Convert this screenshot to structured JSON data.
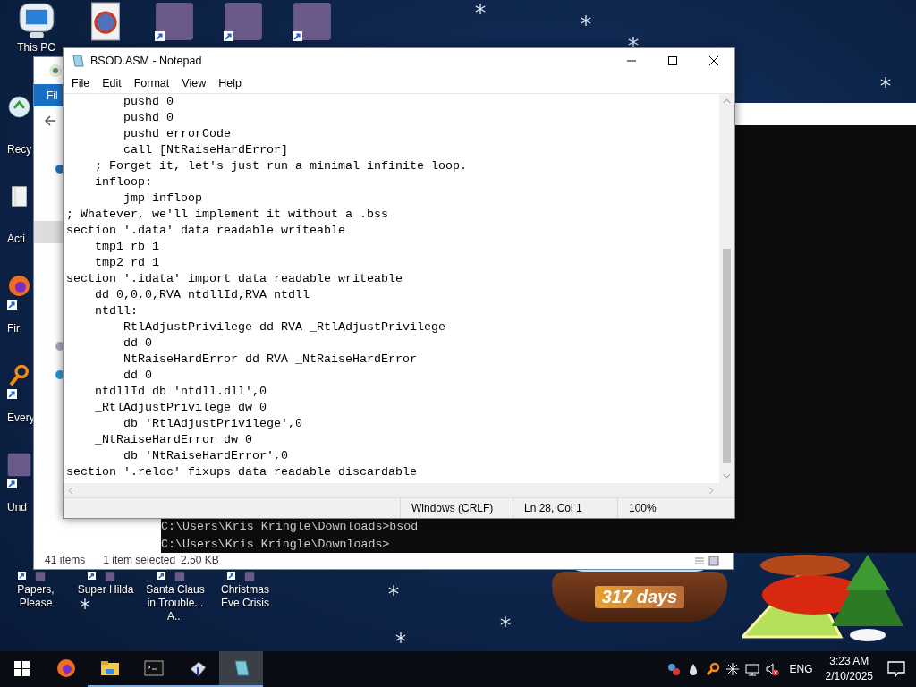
{
  "desktop": {
    "top_icons": [
      {
        "kind": "computer",
        "label": "This PC",
        "shortcut": false
      },
      {
        "kind": "document",
        "shortcut": false
      },
      {
        "kind": "game",
        "shortcut": true
      },
      {
        "kind": "game",
        "shortcut": true
      },
      {
        "kind": "game",
        "shortcut": true
      }
    ],
    "left_icons": [
      {
        "kind": "recycle-bin",
        "label": "Recy",
        "shortcut": false
      },
      {
        "kind": "folder",
        "label": "Acti",
        "shortcut": false
      },
      {
        "kind": "browser",
        "label": "Fir",
        "shortcut": true
      },
      {
        "kind": "search",
        "label": "Every",
        "shortcut": true
      },
      {
        "kind": "game",
        "label": "Und",
        "shortcut": true
      }
    ],
    "bottom_icons": [
      {
        "kind": "game",
        "label": "Papers, Please",
        "shortcut": true
      },
      {
        "kind": "game",
        "label": "Super Hilda",
        "shortcut": true
      },
      {
        "kind": "game",
        "label": "Santa Claus in Trouble... A...",
        "shortcut": true
      },
      {
        "kind": "game",
        "label": "Christmas Eve Crisis",
        "shortcut": true
      }
    ]
  },
  "explorer": {
    "ribbon_tab": "Fil",
    "item_count": "41 items",
    "selection": "1 item selected",
    "selection_size": "2.50 KB"
  },
  "console": {
    "lines": [
      "C:\\Users\\Kris Kringle\\Downloads>bsod",
      "C:\\Users\\Kris Kringle\\Downloads>"
    ]
  },
  "notepad": {
    "title": "BSOD.ASM - Notepad",
    "menu": [
      "File",
      "Edit",
      "Format",
      "View",
      "Help"
    ],
    "lines": [
      "        pushd 0",
      "        pushd 0",
      "        pushd errorCode",
      "        call [NtRaiseHardError]",
      "    ; Forget it, let's just run a minimal infinite loop.",
      "    infloop:",
      "        jmp infloop",
      "; Whatever, we'll implement it without a .bss",
      "section '.data' data readable writeable",
      "    tmp1 rb 1",
      "    tmp2 rd 1",
      "section '.idata' import data readable writeable",
      "    dd 0,0,0,RVA ntdllId,RVA ntdll",
      "    ntdll:",
      "        RtlAdjustPrivilege dd RVA _RtlAdjustPrivilege",
      "        dd 0",
      "        NtRaiseHardError dd RVA _NtRaiseHardError",
      "        dd 0",
      "    ntdllId db 'ntdll.dll',0",
      "    _RtlAdjustPrivilege dw 0",
      "        db 'RtlAdjustPrivilege',0",
      "    _NtRaiseHardError dw 0",
      "        db 'NtRaiseHardError',0",
      "section '.reloc' fixups data readable discardable"
    ],
    "status": [
      "Windows (CRLF)",
      "Ln 28, Col 1",
      "100%"
    ]
  },
  "gadget": {
    "countdown": "317 days"
  },
  "taskbar": {
    "items": [
      {
        "kind": "start",
        "running": false,
        "selected": false
      },
      {
        "kind": "browser",
        "running": false,
        "selected": false
      },
      {
        "kind": "folder",
        "running": true,
        "selected": false
      },
      {
        "kind": "terminal",
        "running": true,
        "selected": false
      },
      {
        "kind": "app",
        "running": true,
        "selected": false
      },
      {
        "kind": "notepad",
        "running": true,
        "selected": true
      }
    ],
    "volume_muted": true,
    "language": "ENG",
    "time": "3:23 AM",
    "date": "2/10/2025"
  }
}
